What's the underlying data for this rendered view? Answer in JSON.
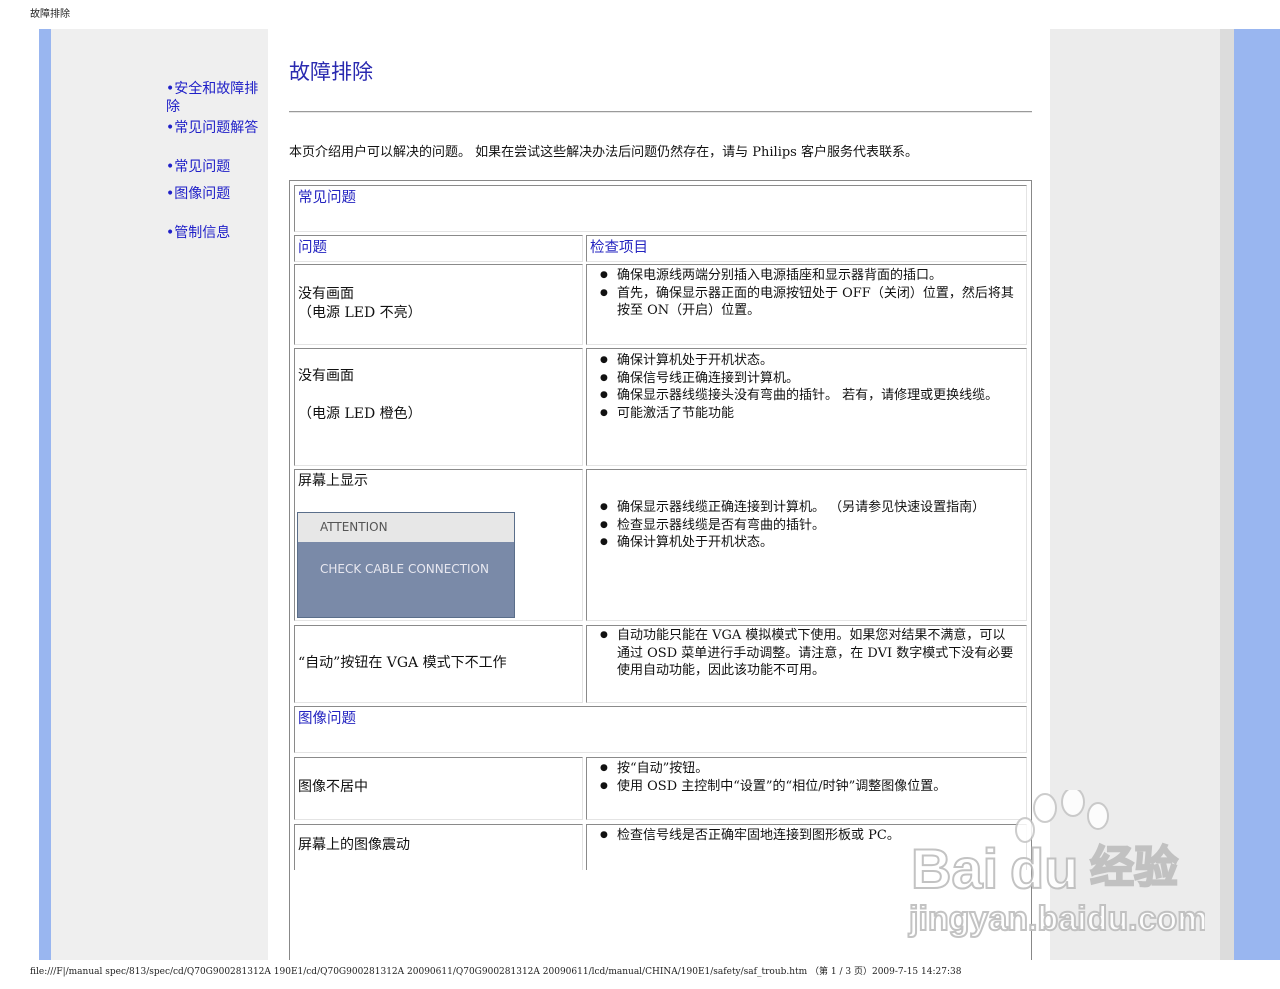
{
  "print_header": "故障排除",
  "print_footer": "file:///F|/manual spec/813/spec/cd/Q70G900281312A 190E1/cd/Q70G900281312A 20090611/Q70G900281312A 20090611/lcd/manual/CHINA/190E1/safety/saf_troub.htm （第 1 / 3 页）2009-7-15 14:27:38",
  "nav": [
    {
      "label": "•安全和故障排除"
    },
    {
      "label": "•常见问题解答"
    },
    {
      "label": "•常见问题"
    },
    {
      "label": "•图像问题"
    },
    {
      "label": "•管制信息"
    }
  ],
  "page_title": "故障排除",
  "intro": "本页介绍用户可以解决的问题。 如果在尝试这些解决办法后问题仍然存在，请与 Philips 客户服务代表联系。",
  "section_common": "常见问题",
  "col_problem": "问题",
  "col_check": "检查项目",
  "rows": [
    {
      "problem_line1": "没有画面",
      "problem_line2": "（电源 LED 不亮）",
      "checks": [
        "确保电源线两端分别插入电源插座和显示器背面的插口。",
        "首先，确保显示器正面的电源按钮处于 OFF（关闭）位置，然后将其按至 ON（开启）位置。"
      ]
    },
    {
      "problem_line1": "没有画面",
      "problem_line2": "（电源 LED 橙色）",
      "checks": [
        "确保计算机处于开机状态。",
        "确保信号线正确连接到计算机。",
        "确保显示器线缆接头没有弯曲的插针。 若有，请修理或更换线缆。",
        "可能激活了节能功能"
      ]
    },
    {
      "problem_line1": "屏幕上显示",
      "attention_title": "ATTENTION",
      "attention_message": "CHECK CABLE CONNECTION",
      "checks": [
        "确保显示器线缆正确连接到计算机。 （另请参见快速设置指南）",
        "检查显示器线缆是否有弯曲的插针。",
        "确保计算机处于开机状态。"
      ]
    },
    {
      "problem_line1": "“自动”按钮在 VGA 模式下不工作",
      "checks": [
        "自动功能只能在 VGA 模拟模式下使用。如果您对结果不满意，可以通过 OSD 菜单进行手动调整。请注意，在 DVI 数字模式下没有必要使用自动功能，因此该功能不可用。"
      ]
    }
  ],
  "section_image": "图像问题",
  "image_rows": [
    {
      "problem": "图像不居中",
      "checks": [
        "按“自动”按钮。",
        "使用 OSD 主控制中“设置”的“相位/时钟”调整图像位置。"
      ]
    },
    {
      "problem": "屏幕上的图像震动",
      "checks": [
        "检查信号线是否正确牢固地连接到图形板或 PC。"
      ]
    }
  ],
  "watermark_brand": "Bai",
  "watermark_brand2": "du",
  "watermark_cn": "经验",
  "watermark_url": "jingyan.baidu.com"
}
